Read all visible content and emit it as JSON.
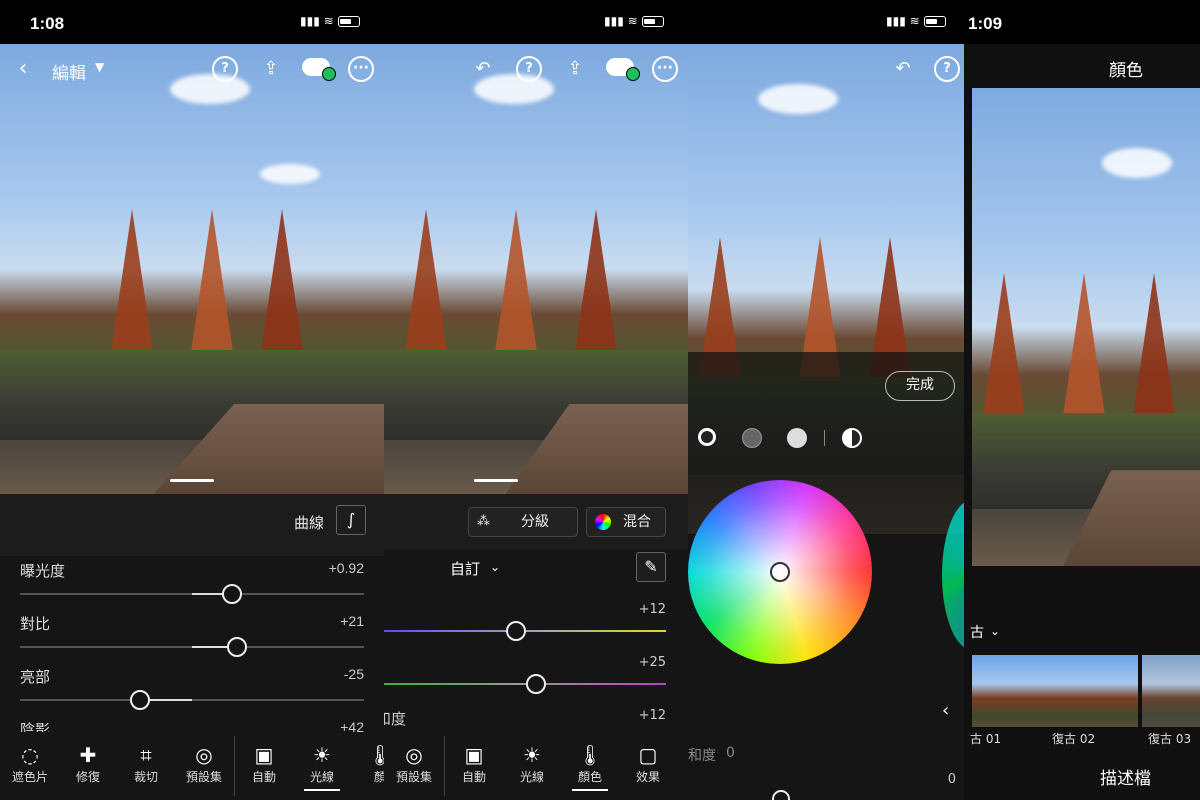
{
  "panel1": {
    "status_time": "1:08",
    "title": "編輯",
    "curve_label": "曲線",
    "sliders": [
      {
        "name": "曝光度",
        "value": "+0.92",
        "level": 0.615
      },
      {
        "name": "對比",
        "value": "+21",
        "level": 0.63
      },
      {
        "name": "亮部",
        "value": "-25",
        "level": 0.35
      },
      {
        "name": "陰影",
        "value": "+42",
        "level": 0.7
      }
    ],
    "tools": [
      {
        "label": "遮色片",
        "icon": "mask-icon"
      },
      {
        "label": "修復",
        "icon": "bandage-icon"
      },
      {
        "label": "裁切",
        "icon": "crop-icon"
      },
      {
        "label": "預設集",
        "icon": "presets-icon"
      },
      {
        "label": "自動",
        "icon": "auto-icon"
      },
      {
        "label": "光線",
        "icon": "sun-icon"
      },
      {
        "label": "顏",
        "icon": "thermometer-icon"
      }
    ]
  },
  "panel2": {
    "grading_label": "分級",
    "mix_label": "混合",
    "mode_label": "自訂",
    "values": [
      "+12",
      "+25",
      "+12"
    ],
    "partial_label": "和度",
    "tools": [
      {
        "label": "預設集",
        "icon": "presets-icon"
      },
      {
        "label": "自動",
        "icon": "auto-icon"
      },
      {
        "label": "光線",
        "icon": "sun-icon"
      },
      {
        "label": "顏色",
        "icon": "thermometer-icon"
      },
      {
        "label": "效果",
        "icon": "effects-icon"
      }
    ]
  },
  "panel3": {
    "done_label": "完成",
    "saturation_label": "和度",
    "saturation_value": "0",
    "right_value": "0"
  },
  "panel4": {
    "status_time": "1:09",
    "title": "顏色",
    "category": "古",
    "thumbs": [
      "古 01",
      "復古 02",
      "復古 03"
    ],
    "profile_label": "描述檔"
  }
}
